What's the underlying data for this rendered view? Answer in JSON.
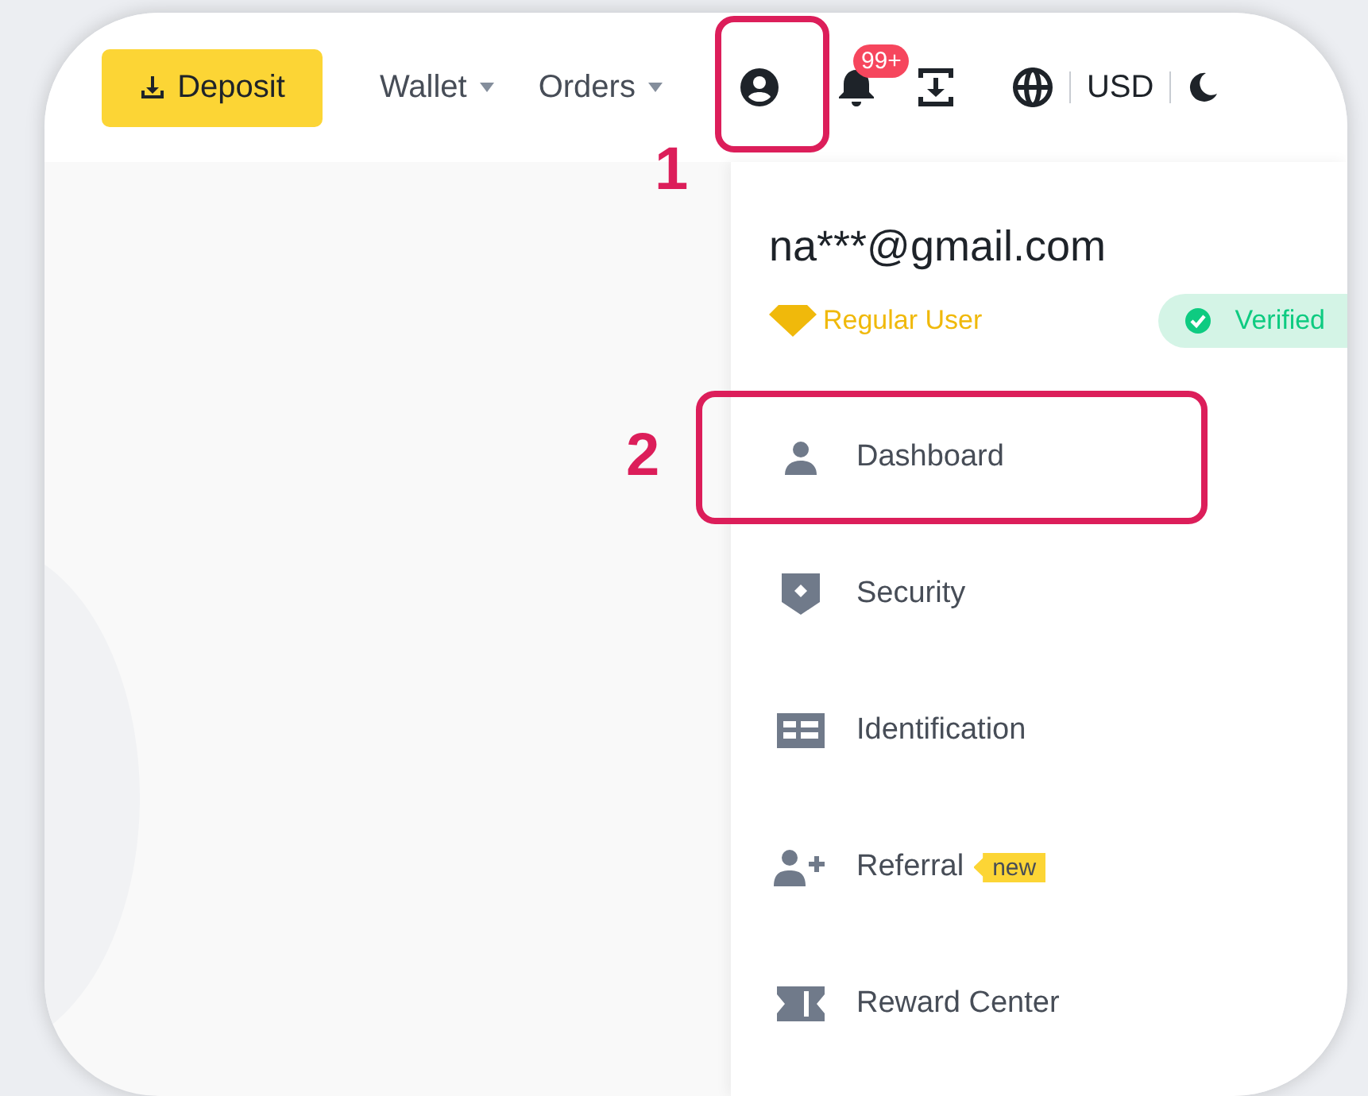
{
  "header": {
    "deposit_button": "Deposit",
    "nav": [
      {
        "label": "Wallet"
      },
      {
        "label": "Orders"
      }
    ],
    "notification_badge": "99+",
    "currency": "USD"
  },
  "account_menu": {
    "email": "na***@gmail.com",
    "user_level": "Regular User",
    "verification": "Verified",
    "items": [
      {
        "label": "Dashboard"
      },
      {
        "label": "Security"
      },
      {
        "label": "Identification"
      },
      {
        "label": "Referral",
        "tag": "new"
      },
      {
        "label": "Reward Center"
      }
    ]
  },
  "annotations": [
    {
      "label": "1"
    },
    {
      "label": "2"
    }
  ]
}
